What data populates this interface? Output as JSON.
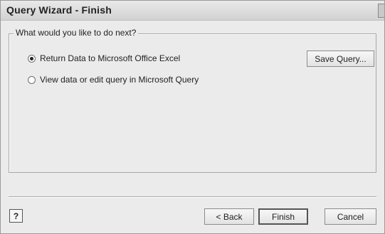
{
  "window": {
    "title": "Query Wizard - Finish",
    "close_glyph": "×"
  },
  "group": {
    "legend": "What would you like to do next?"
  },
  "options": [
    {
      "label": "Return Data to Microsoft Office Excel",
      "selected": true
    },
    {
      "label": "View data or edit query in Microsoft Query",
      "selected": false
    }
  ],
  "buttons": {
    "save_query": "Save Query...",
    "back": "< Back",
    "finish": "Finish",
    "cancel": "Cancel"
  },
  "help": {
    "icon": "help-icon",
    "glyph": "?"
  }
}
